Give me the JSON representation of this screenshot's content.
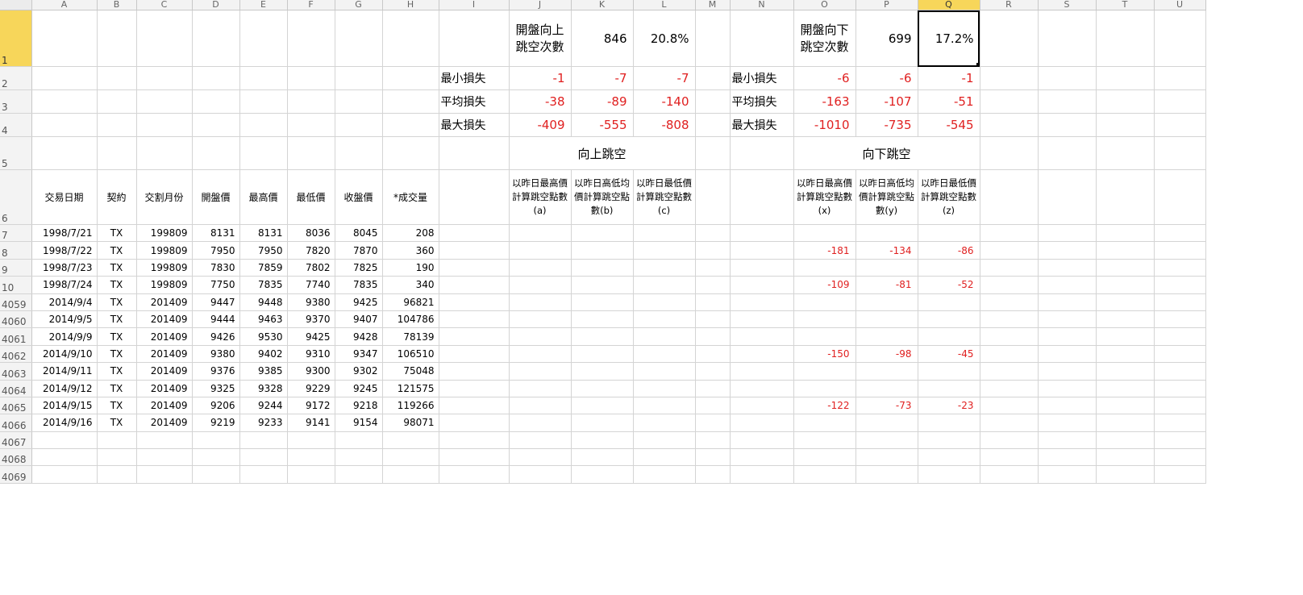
{
  "columns": [
    "",
    "A",
    "B",
    "C",
    "D",
    "E",
    "F",
    "G",
    "H",
    "I",
    "J",
    "K",
    "L",
    "M",
    "N",
    "O",
    "P",
    "Q",
    "R",
    "S",
    "T",
    "U"
  ],
  "selected_cell": "Q1",
  "summary": {
    "up_title": "開盤向上\n跳空次數",
    "up_count": "846",
    "up_pct": "20.8%",
    "down_title": "開盤向下\n跳空次數",
    "down_count": "699",
    "down_pct": "17.2%",
    "stats": [
      {
        "label": "最小損失",
        "up": [
          "-1",
          "-7",
          "-7"
        ],
        "down": [
          "-6",
          "-6",
          "-1"
        ]
      },
      {
        "label": "平均損失",
        "up": [
          "-38",
          "-89",
          "-140"
        ],
        "down": [
          "-163",
          "-107",
          "-51"
        ]
      },
      {
        "label": "最大損失",
        "up": [
          "-409",
          "-555",
          "-808"
        ],
        "down": [
          "-1010",
          "-735",
          "-545"
        ]
      }
    ],
    "up_section": "向上跳空",
    "down_section": "向下跳空",
    "up_headers": [
      "以昨日最高價計算跳空點數(a)",
      "以昨日高低均價計算跳空點數(b)",
      "以昨日最低價計算跳空點數(c)"
    ],
    "down_headers": [
      "以昨日最高價計算跳空點數(x)",
      "以昨日高低均價計算跳空點數(y)",
      "以昨日最低價計算跳空點數(z)"
    ]
  },
  "table_headers": [
    "交易日期",
    "契約",
    "交割月份",
    "開盤價",
    "最高價",
    "最低價",
    "收盤價",
    "*成交量"
  ],
  "rows": [
    {
      "n": "7",
      "date": "1998/7/21",
      "contract": "TX",
      "month": "199809",
      "open": "8131",
      "high": "8131",
      "low": "8036",
      "close": "8045",
      "vol": "208",
      "down": [
        "",
        "",
        ""
      ]
    },
    {
      "n": "8",
      "date": "1998/7/22",
      "contract": "TX",
      "month": "199809",
      "open": "7950",
      "high": "7950",
      "low": "7820",
      "close": "7870",
      "vol": "360",
      "down": [
        "-181",
        "-134",
        "-86"
      ]
    },
    {
      "n": "9",
      "date": "1998/7/23",
      "contract": "TX",
      "month": "199809",
      "open": "7830",
      "high": "7859",
      "low": "7802",
      "close": "7825",
      "vol": "190",
      "down": [
        "",
        "",
        ""
      ]
    },
    {
      "n": "10",
      "date": "1998/7/24",
      "contract": "TX",
      "month": "199809",
      "open": "7750",
      "high": "7835",
      "low": "7740",
      "close": "7835",
      "vol": "340",
      "down": [
        "-109",
        "-81",
        "-52"
      ]
    },
    {
      "n": "4059",
      "date": "2014/9/4",
      "contract": "TX",
      "month": "201409",
      "open": "9447",
      "high": "9448",
      "low": "9380",
      "close": "9425",
      "vol": "96821",
      "down": [
        "",
        "",
        ""
      ]
    },
    {
      "n": "4060",
      "date": "2014/9/5",
      "contract": "TX",
      "month": "201409",
      "open": "9444",
      "high": "9463",
      "low": "9370",
      "close": "9407",
      "vol": "104786",
      "down": [
        "",
        "",
        ""
      ]
    },
    {
      "n": "4061",
      "date": "2014/9/9",
      "contract": "TX",
      "month": "201409",
      "open": "9426",
      "high": "9530",
      "low": "9425",
      "close": "9428",
      "vol": "78139",
      "down": [
        "",
        "",
        ""
      ]
    },
    {
      "n": "4062",
      "date": "2014/9/10",
      "contract": "TX",
      "month": "201409",
      "open": "9380",
      "high": "9402",
      "low": "9310",
      "close": "9347",
      "vol": "106510",
      "down": [
        "-150",
        "-98",
        "-45"
      ]
    },
    {
      "n": "4063",
      "date": "2014/9/11",
      "contract": "TX",
      "month": "201409",
      "open": "9376",
      "high": "9385",
      "low": "9300",
      "close": "9302",
      "vol": "75048",
      "down": [
        "",
        "",
        ""
      ]
    },
    {
      "n": "4064",
      "date": "2014/9/12",
      "contract": "TX",
      "month": "201409",
      "open": "9325",
      "high": "9328",
      "low": "9229",
      "close": "9245",
      "vol": "121575",
      "down": [
        "",
        "",
        ""
      ]
    },
    {
      "n": "4065",
      "date": "2014/9/15",
      "contract": "TX",
      "month": "201409",
      "open": "9206",
      "high": "9244",
      "low": "9172",
      "close": "9218",
      "vol": "119266",
      "down": [
        "-122",
        "-73",
        "-23"
      ]
    },
    {
      "n": "4066",
      "date": "2014/9/16",
      "contract": "TX",
      "month": "201409",
      "open": "9219",
      "high": "9233",
      "low": "9141",
      "close": "9154",
      "vol": "98071",
      "down": [
        "",
        "",
        ""
      ]
    }
  ],
  "empty_rows": [
    "4067",
    "4068",
    "4069"
  ],
  "header_rows": [
    "1",
    "2",
    "3",
    "4",
    "5",
    "6"
  ]
}
